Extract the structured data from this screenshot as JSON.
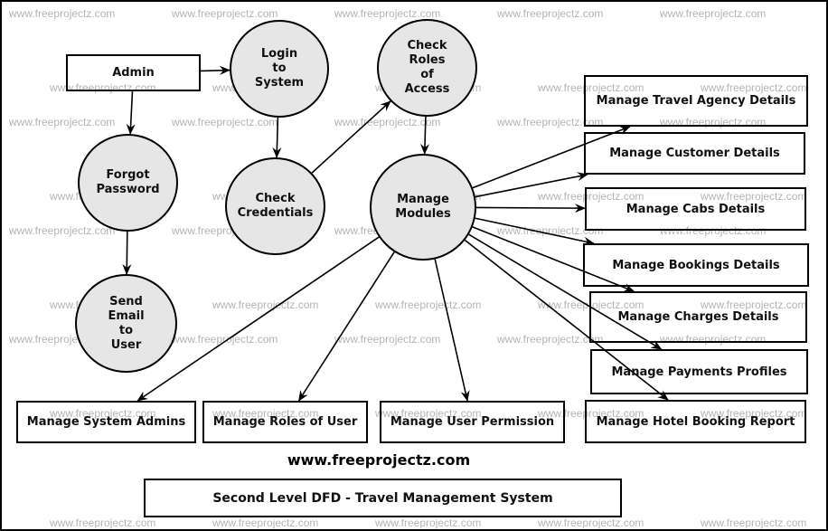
{
  "diagram": {
    "title": "Second Level DFD - Travel Management System",
    "website": "www.freeprojectz.com",
    "watermark": "www.freeprojectz.com",
    "external_entity": {
      "id": "admin",
      "label": "Admin"
    },
    "processes": [
      {
        "id": "login",
        "label": "Login\nto\nSystem"
      },
      {
        "id": "check_roles",
        "label": "Check\nRoles\nof\nAccess"
      },
      {
        "id": "forgot",
        "label": "Forgot\nPassword"
      },
      {
        "id": "check_cred",
        "label": "Check\nCredentials"
      },
      {
        "id": "manage_modules",
        "label": "Manage\nModules"
      },
      {
        "id": "send_email",
        "label": "Send\nEmail\nto\nUser"
      }
    ],
    "modules": [
      {
        "id": "travel_agency",
        "label": "Manage Travel Agency Details"
      },
      {
        "id": "customer",
        "label": "Manage Customer Details"
      },
      {
        "id": "cabs",
        "label": "Manage Cabs Details"
      },
      {
        "id": "bookings",
        "label": "Manage Bookings Details"
      },
      {
        "id": "charges",
        "label": "Manage Charges Details"
      },
      {
        "id": "payments",
        "label": "Manage Payments Profiles"
      },
      {
        "id": "hotel",
        "label": "Manage Hotel Booking Report"
      },
      {
        "id": "sys_admins",
        "label": "Manage System Admins"
      },
      {
        "id": "roles_user",
        "label": "Manage Roles of User"
      },
      {
        "id": "user_perm",
        "label": "Manage User Permission"
      }
    ],
    "flows": [
      [
        "admin",
        "login"
      ],
      [
        "admin",
        "forgot"
      ],
      [
        "login",
        "check_cred"
      ],
      [
        "check_cred",
        "check_roles"
      ],
      [
        "check_roles",
        "manage_modules"
      ],
      [
        "forgot",
        "send_email"
      ],
      [
        "manage_modules",
        "travel_agency"
      ],
      [
        "manage_modules",
        "customer"
      ],
      [
        "manage_modules",
        "cabs"
      ],
      [
        "manage_modules",
        "bookings"
      ],
      [
        "manage_modules",
        "charges"
      ],
      [
        "manage_modules",
        "payments"
      ],
      [
        "manage_modules",
        "hotel"
      ],
      [
        "manage_modules",
        "sys_admins"
      ],
      [
        "manage_modules",
        "roles_user"
      ],
      [
        "manage_modules",
        "user_perm"
      ]
    ]
  }
}
